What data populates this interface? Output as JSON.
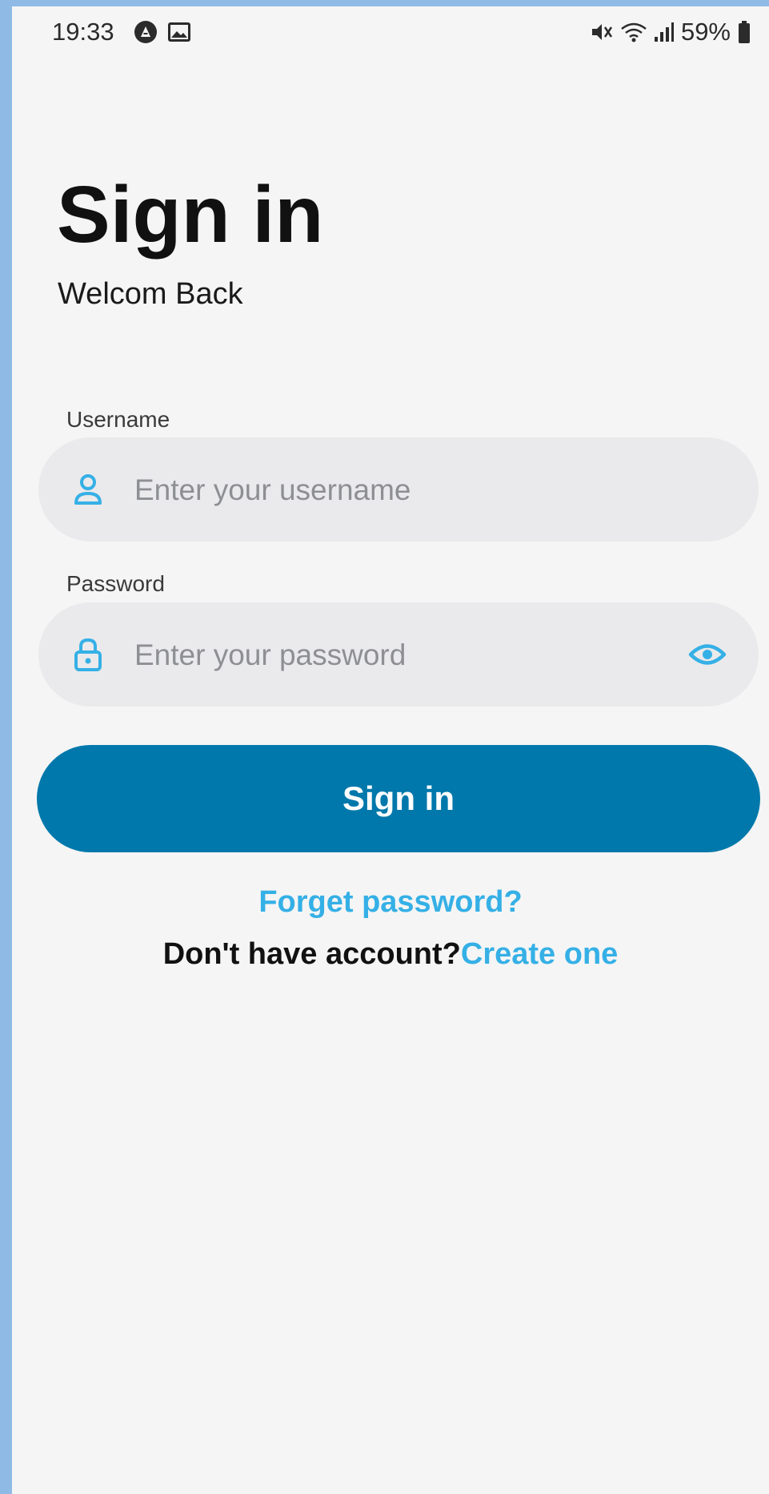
{
  "status_bar": {
    "time": "19:33",
    "battery": "59%",
    "left_icons": [
      "app-notification-icon",
      "image-notification-icon"
    ],
    "right_icons": [
      "mute-icon",
      "wifi-icon",
      "signal-icon",
      "battery-icon"
    ]
  },
  "header": {
    "title": "Sign in",
    "subtitle": "Welcom Back"
  },
  "form": {
    "username": {
      "label": "Username",
      "value": "",
      "placeholder": "Enter your username",
      "icon": "user-icon"
    },
    "password": {
      "label": "Password",
      "value": "",
      "placeholder": "Enter your password",
      "icon": "lock-icon",
      "toggle_icon": "eye-icon"
    },
    "submit_label": "Sign in"
  },
  "links": {
    "forgot_password": "Forget password?",
    "signup_prompt": "Don't have account?",
    "signup_link": "Create one"
  },
  "colors": {
    "primary": "#0178ab",
    "link": "#35b0e6",
    "icon": "#35b0e6",
    "input_background": "#eaeaec",
    "page_background": "#f5f5f5",
    "outer_frame": "#8fbae6"
  }
}
